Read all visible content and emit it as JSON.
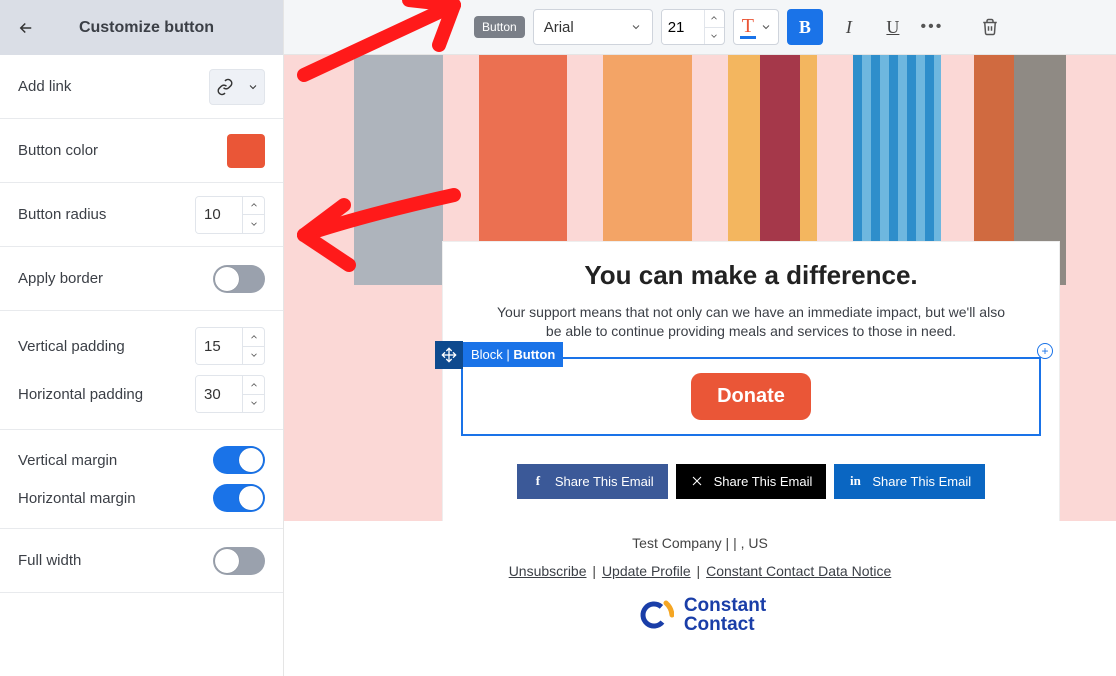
{
  "sidebar": {
    "title": "Customize button",
    "add_link": {
      "label": "Add link"
    },
    "button_color": {
      "label": "Button color",
      "value": "#ea5637"
    },
    "button_radius": {
      "label": "Button radius",
      "value": "10"
    },
    "apply_border": {
      "label": "Apply border",
      "on": false
    },
    "vertical_padding": {
      "label": "Vertical padding",
      "value": "15"
    },
    "horizontal_padding": {
      "label": "Horizontal padding",
      "value": "30"
    },
    "vertical_margin": {
      "label": "Vertical margin",
      "on": true
    },
    "horizontal_margin": {
      "label": "Horizontal margin",
      "on": true
    },
    "full_width": {
      "label": "Full width",
      "on": false
    }
  },
  "toolbar": {
    "element_type": "Button",
    "font_family": "Arial",
    "font_size": "21",
    "bold_label": "B",
    "italic_label": "I",
    "underline_label": "U",
    "more_label": "•••"
  },
  "colors": {
    "accent": "#ea5637",
    "primary": "#1a73e8",
    "canvas_bg": "#fbd8d6"
  },
  "canvas": {
    "heading": "You can make a difference.",
    "body": "Your support means that not only can we have an immediate impact, but we'll also be able to continue providing meals and services to those in need.",
    "block_label_prefix": "Block | ",
    "block_label_type": "Button",
    "donate_label": "Donate",
    "share": {
      "fb": "Share This Email",
      "x": "Share This Email",
      "li": "Share This Email"
    }
  },
  "footer": {
    "company": "Test Company |  | , US",
    "unsubscribe": "Unsubscribe",
    "update_profile": "Update Profile",
    "data_notice": "Constant Contact Data Notice",
    "logo_line1": "Constant",
    "logo_line2": "Contact"
  }
}
